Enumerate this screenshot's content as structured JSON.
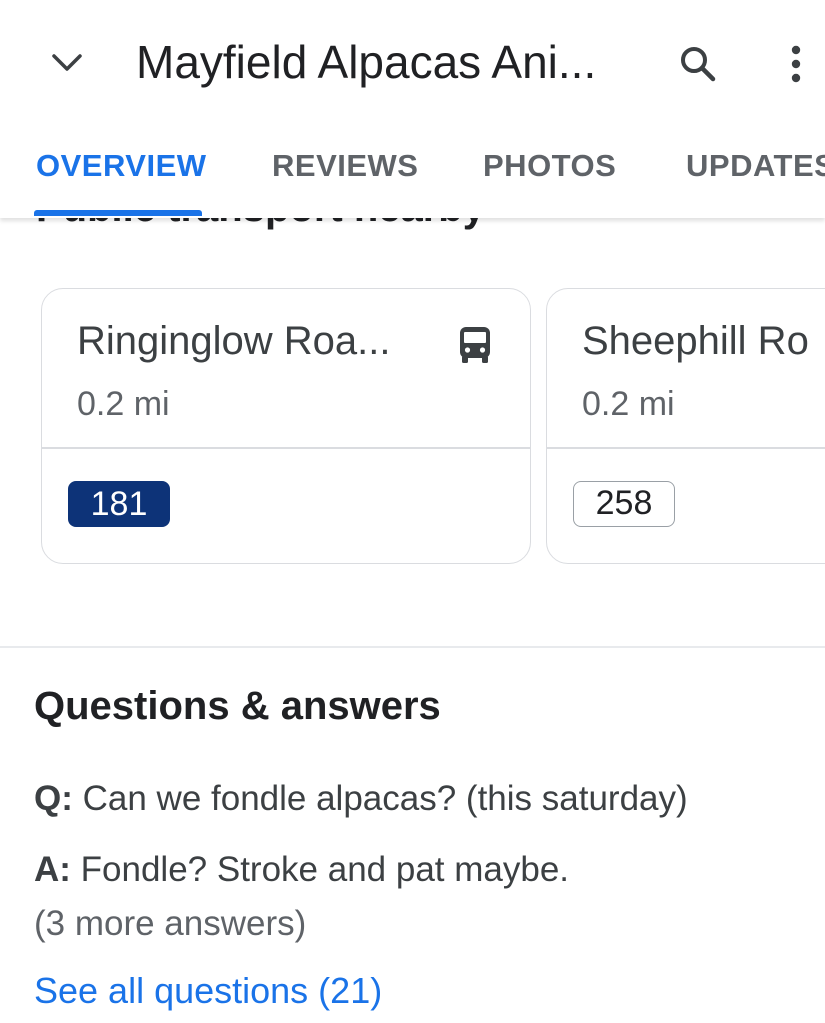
{
  "header": {
    "title": "Mayfield Alpacas Ani...",
    "collapse_icon": "chevron-down-icon",
    "search_icon": "search-icon",
    "more_icon": "more-vert-icon"
  },
  "tabs": [
    {
      "label": "OVERVIEW",
      "active": true
    },
    {
      "label": "REVIEWS",
      "active": false
    },
    {
      "label": "PHOTOS",
      "active": false
    },
    {
      "label": "UPDATES",
      "active": false
    }
  ],
  "transport": {
    "heading": "Public transport nearby",
    "stops": [
      {
        "name": "Ringinglow Roa...",
        "distance": "0.2 mi",
        "route": "181",
        "route_style": "filled",
        "icon": "bus-icon"
      },
      {
        "name": "Sheephill Ro",
        "distance": "0.2 mi",
        "route": "258",
        "route_style": "outline"
      }
    ]
  },
  "qa": {
    "heading": "Questions & answers",
    "question_prefix": "Q:",
    "question": " Can we fondle alpacas? (this saturday)",
    "answer_prefix": "A:",
    "answer": " Fondle? Stroke and pat maybe.",
    "more_answers": "(3 more answers)",
    "see_all": "See all questions (21)"
  },
  "colors": {
    "accent": "#1a73e8",
    "route_filled": "#0d3378",
    "divider": "#dadce0"
  }
}
